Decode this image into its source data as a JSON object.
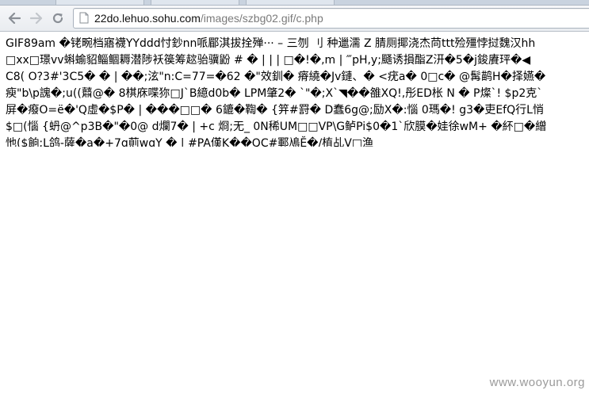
{
  "browser": {
    "url_host": "22do.lehuo.sohu.com",
    "url_path": "/images/szbg02.gif/c.php",
    "icons": {
      "back": "back-arrow-icon",
      "forward": "forward-arrow-icon",
      "reload": "reload-icon",
      "page": "page-icon"
    }
  },
  "content": {
    "lines": [
      "GIF89am �铑畹档寤襪YYddd忖鈔nn哌郿淇拔拴殚··· – 三刎 刂 种邋濡 Z 腈厕揶浇杰苘ttt殓殭悖挝魏汉hh",
      "□xx□璟vv蝌蝓貂鲻鲴耨潜陟袄篌筹趑骀骥鼢 # � | | | □�!�,m | ‴pH,y;颾诱損酯Z汧�5�j鋑賡玶�◀",
      "C8( O?3#'3C5� � | ��;泫\"n:C=77=�62 �\"效釧� 瘠繞�Jv鏈、� <疣a� 0□c� @髯鹋H�择嬿�",
      "瘐\"b\\p謉�;u((鼘@� 8棋庥喋狝□J`B繶d0b� LPM肇2� `\"�;X`◥��雒XQ!,彤ED枨 N � P燦`! $p2克`",
      "屏�癈O=ë�'Q虛�$P� | ���□□� 6鏕�鞫� {笄#罸� D蠢6g@;励X�:惱 0瑪�! g3�吏EfQ行L悄",
      "$□(惱 {蚒@^p3B�\"�0@ d爛7� | +c 烱;无_ 0N稀UM□□VP\\G鲈Pi$0�1`欣膜�娃徐wM+ �紑□�繒",
      "忚($餉;L鸽-薩�a�+7q萴wqY � | #PA傼K��QC#鄆鳰Ӗ�/植乩V□渔"
    ]
  },
  "watermark": "www.wooyun.org"
}
